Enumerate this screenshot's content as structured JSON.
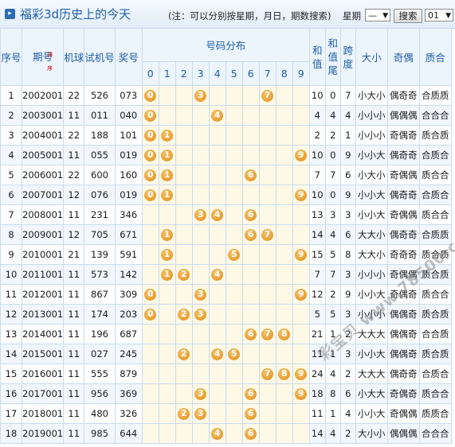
{
  "header": {
    "icon_glyph": "▸",
    "title": "福彩3d历史上的今天",
    "note": "(注：可以分别按星期，月日，期数搜索)",
    "week_label": "星期",
    "week_value": "—",
    "search_label": "搜索",
    "day_value": "01"
  },
  "columns": {
    "seq": "序号",
    "issue": "期号",
    "sort_icon_label": "排序",
    "machine": "机球",
    "trial": "试机号",
    "prize": "奖号",
    "dist": "号码分布",
    "digits": [
      "0",
      "1",
      "2",
      "3",
      "4",
      "5",
      "6",
      "7",
      "8",
      "9"
    ],
    "sum": "和值",
    "sum_tail": "和值尾",
    "span": "跨度",
    "size": "大小",
    "parity": "奇偶",
    "prime": "质合"
  },
  "rows": [
    {
      "seq": "1",
      "issue": "2002001",
      "machine": "22",
      "trial": "526",
      "prize": "073",
      "sum": "10",
      "tail": "0",
      "span": "7",
      "size": "小大小",
      "parity": "偶奇奇",
      "prime": "合质质"
    },
    {
      "seq": "2",
      "issue": "2003001",
      "machine": "11",
      "trial": "011",
      "prize": "040",
      "sum": "4",
      "tail": "4",
      "span": "4",
      "size": "小小小",
      "parity": "偶偶偶",
      "prime": "合合合"
    },
    {
      "seq": "3",
      "issue": "2004001",
      "machine": "22",
      "trial": "188",
      "prize": "101",
      "sum": "2",
      "tail": "2",
      "span": "1",
      "size": "小小小",
      "parity": "奇偶奇",
      "prime": "质合质"
    },
    {
      "seq": "4",
      "issue": "2005001",
      "machine": "11",
      "trial": "055",
      "prize": "019",
      "sum": "10",
      "tail": "0",
      "span": "9",
      "size": "小小大",
      "parity": "偶奇奇",
      "prime": "合质合"
    },
    {
      "seq": "5",
      "issue": "2006001",
      "machine": "22",
      "trial": "600",
      "prize": "160",
      "sum": "7",
      "tail": "7",
      "span": "6",
      "size": "小大小",
      "parity": "奇偶偶",
      "prime": "质合合"
    },
    {
      "seq": "6",
      "issue": "2007001",
      "machine": "12",
      "trial": "076",
      "prize": "019",
      "sum": "10",
      "tail": "0",
      "span": "9",
      "size": "小小大",
      "parity": "偶奇奇",
      "prime": "合质合"
    },
    {
      "seq": "7",
      "issue": "2008001",
      "machine": "11",
      "trial": "231",
      "prize": "346",
      "sum": "13",
      "tail": "3",
      "span": "3",
      "size": "小小大",
      "parity": "奇偶偶",
      "prime": "质合合"
    },
    {
      "seq": "8",
      "issue": "2009001",
      "machine": "12",
      "trial": "705",
      "prize": "671",
      "sum": "14",
      "tail": "4",
      "span": "6",
      "size": "大大小",
      "parity": "偶奇奇",
      "prime": "合质质"
    },
    {
      "seq": "9",
      "issue": "2010001",
      "machine": "21",
      "trial": "139",
      "prize": "591",
      "sum": "15",
      "tail": "5",
      "span": "8",
      "size": "大大小",
      "parity": "奇奇奇",
      "prime": "质合质"
    },
    {
      "seq": "10",
      "issue": "2011001",
      "machine": "11",
      "trial": "573",
      "prize": "142",
      "sum": "7",
      "tail": "7",
      "span": "3",
      "size": "小小小",
      "parity": "奇偶偶",
      "prime": "质合质"
    },
    {
      "seq": "11",
      "issue": "2012001",
      "machine": "11",
      "trial": "867",
      "prize": "309",
      "sum": "12",
      "tail": "2",
      "span": "9",
      "size": "小小大",
      "parity": "奇偶奇",
      "prime": "质合合"
    },
    {
      "seq": "12",
      "issue": "2013001",
      "machine": "11",
      "trial": "174",
      "prize": "203",
      "sum": "5",
      "tail": "5",
      "span": "3",
      "size": "小小小",
      "parity": "偶偶奇",
      "prime": "质合质"
    },
    {
      "seq": "13",
      "issue": "2014001",
      "machine": "11",
      "trial": "196",
      "prize": "687",
      "sum": "21",
      "tail": "1",
      "span": "2",
      "size": "大大大",
      "parity": "偶偶奇",
      "prime": "合合质"
    },
    {
      "seq": "14",
      "issue": "2015001",
      "machine": "11",
      "trial": "027",
      "prize": "245",
      "sum": "11",
      "tail": "1",
      "span": "3",
      "size": "小小大",
      "parity": "偶偶奇",
      "prime": "质合质"
    },
    {
      "seq": "15",
      "issue": "2016001",
      "machine": "11",
      "trial": "555",
      "prize": "879",
      "sum": "24",
      "tail": "4",
      "span": "2",
      "size": "大大大",
      "parity": "偶奇奇",
      "prime": "合质合"
    },
    {
      "seq": "16",
      "issue": "2017001",
      "machine": "11",
      "trial": "956",
      "prize": "369",
      "sum": "18",
      "tail": "8",
      "span": "6",
      "size": "小大大",
      "parity": "奇偶奇",
      "prime": "质合合"
    },
    {
      "seq": "17",
      "issue": "2018001",
      "machine": "11",
      "trial": "480",
      "prize": "326",
      "sum": "11",
      "tail": "1",
      "span": "4",
      "size": "小小大",
      "parity": "奇偶偶",
      "prime": "质质合"
    },
    {
      "seq": "18",
      "issue": "2019001",
      "machine": "11",
      "trial": "985",
      "prize": "644",
      "sum": "14",
      "tail": "4",
      "span": "2",
      "size": "大小小",
      "parity": "偶偶偶",
      "prime": "合合合"
    }
  ],
  "watermark": "彩宝贝 www.78500.cn",
  "colors": {
    "accent": "#1f5fa8",
    "ball": "#e89a2a",
    "header_bg": "#ecf4fc",
    "dist_bg": "#fdf9e6"
  }
}
